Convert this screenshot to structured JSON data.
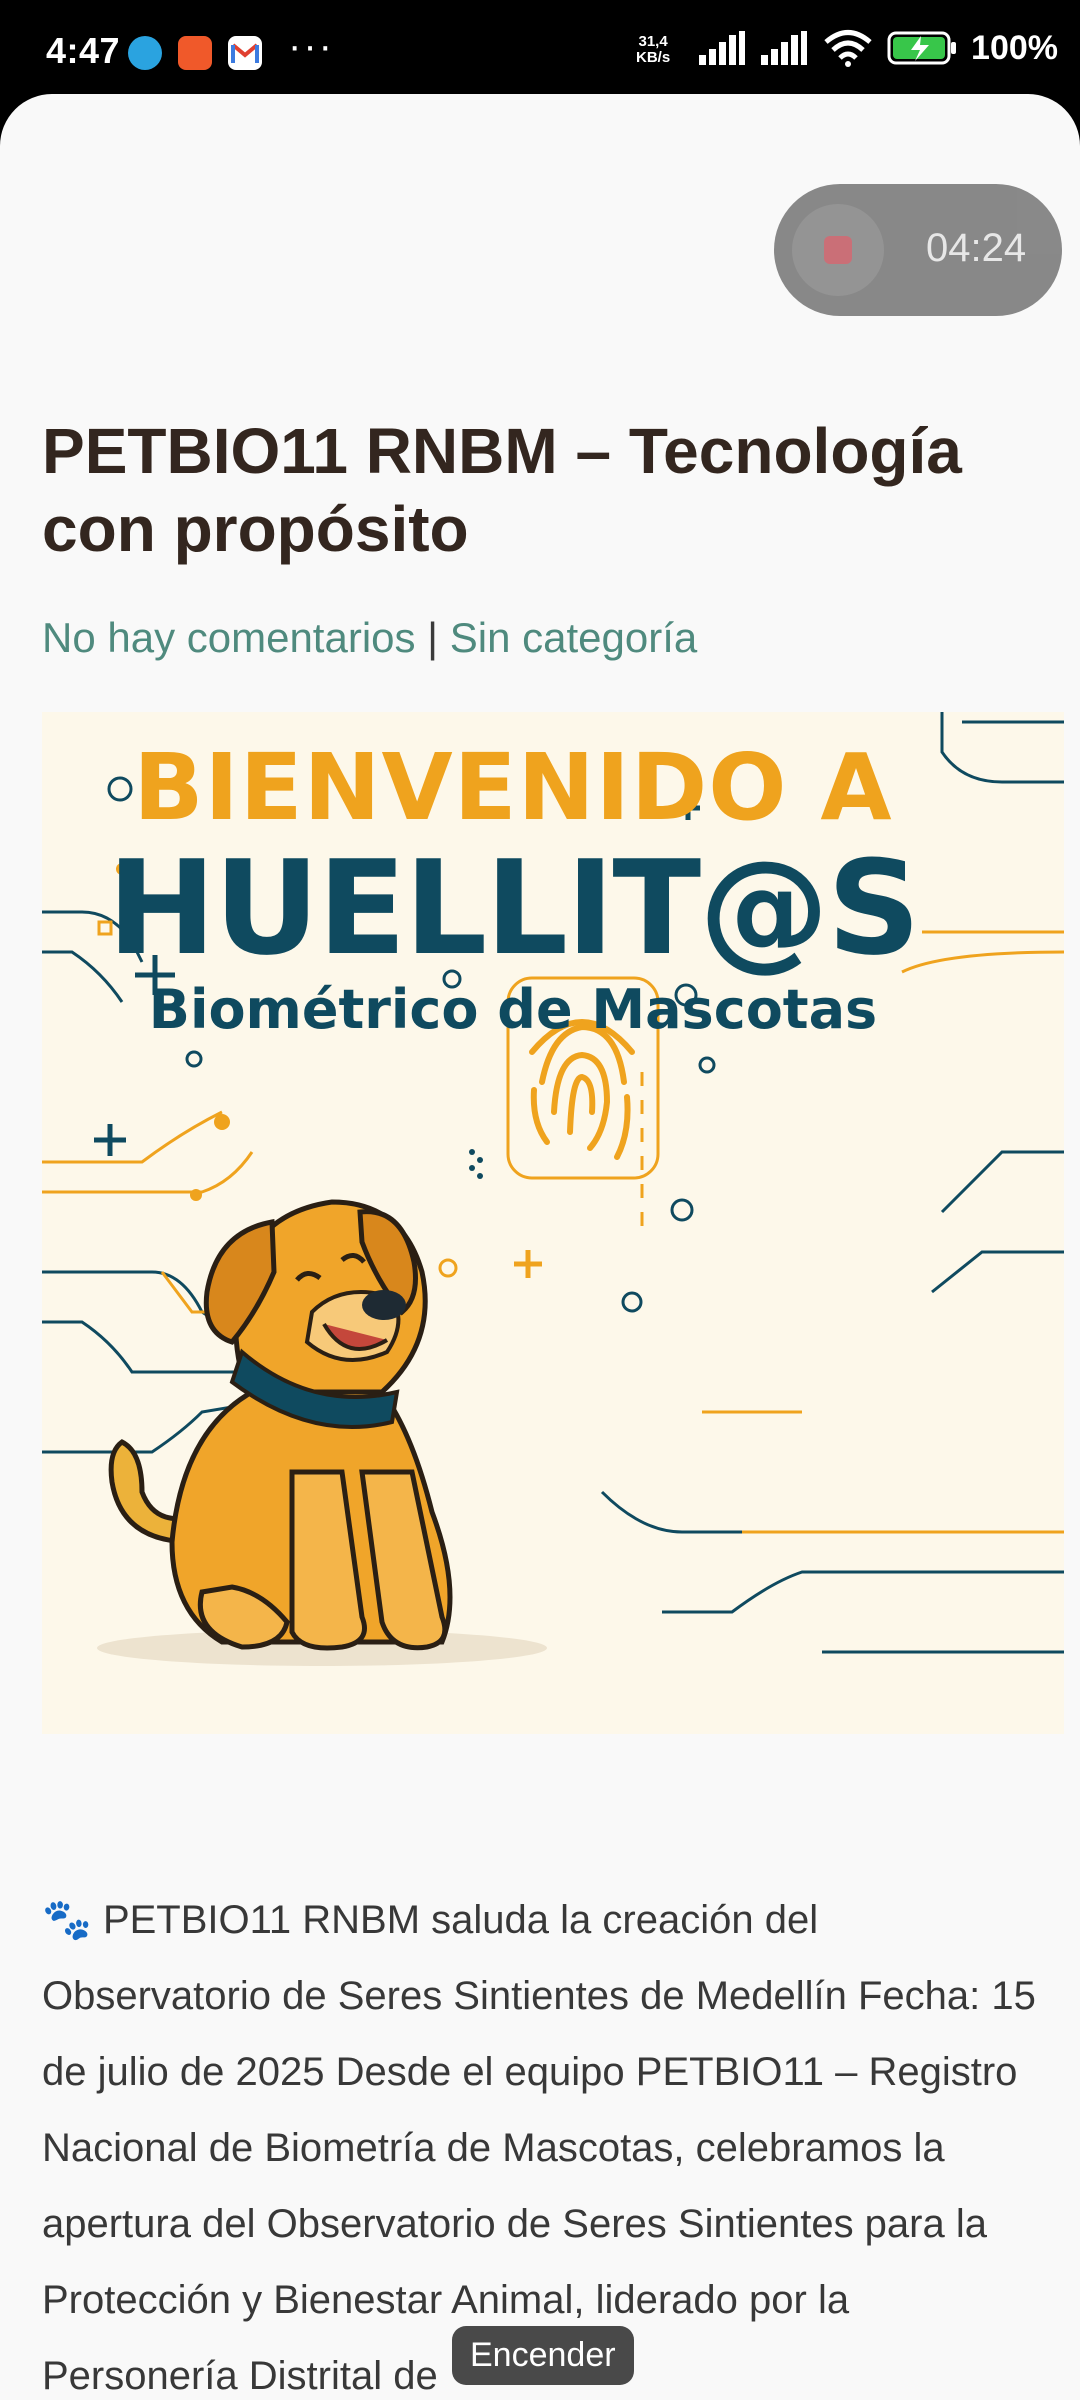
{
  "status_bar": {
    "time": "4:47",
    "net_speed_value": "31,4",
    "net_speed_unit": "KB/s",
    "battery_pct": "100%",
    "dots": "···",
    "apps": [
      "telegram-icon",
      "video-recorder-icon",
      "gmail-icon"
    ]
  },
  "recorder": {
    "elapsed": "04:24"
  },
  "article": {
    "title": "PETBIO11 RNBM – Tecnología con propósito",
    "comments_link": "No hay comentarios",
    "separator": " | ",
    "category_link": "Sin categoría",
    "hero": {
      "line1": "BIENVENIDO A",
      "line2": "HUELLIT@S",
      "line3": "Biométrico de Mascotas"
    },
    "body": "PETBIO11 RNBM saluda la creación del Observatorio de Seres Sintientes de Medellín Fecha: 15 de julio de 2025 Desde el equipo PETBIO11 – Registro Nacional de Biometría de Mascotas, celebramos la apertura del Observatorio de Seres Sintientes para la Protección y Bienestar Animal, liderado por la Personería Distrital de",
    "body_icon": "🐾"
  },
  "toast": {
    "text": "Encender"
  },
  "colors": {
    "accent_link": "#4f8a7e",
    "title_text": "#33261f",
    "hero_orange": "#efa31e",
    "hero_navy": "#0f4a5f"
  }
}
